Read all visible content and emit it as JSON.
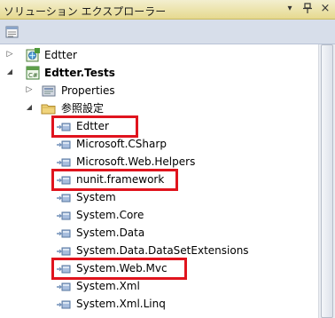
{
  "window": {
    "title": "ソリューション エクスプローラー",
    "dropdown_icon": "dropdown-arrow-icon",
    "pin_icon": "pin-icon",
    "close_icon": "close-icon",
    "pin_glyph": "ㅁ",
    "close_glyph": "×",
    "dropdown_glyph": "▾"
  },
  "toolbar": {
    "properties_icon": "properties-icon"
  },
  "tree": {
    "project_edtter": {
      "label": "Edtter",
      "expander": "▷"
    },
    "project_tests": {
      "label": "Edtter.Tests",
      "expander": "◢"
    },
    "properties": {
      "label": "Properties",
      "expander": "▷"
    },
    "references": {
      "label": "参照設定",
      "expander": "◢"
    },
    "refs": [
      "Edtter",
      "Microsoft.CSharp",
      "Microsoft.Web.Helpers",
      "nunit.framework",
      "System",
      "System.Core",
      "System.Data",
      "System.Data.DataSetExtensions",
      "System.Web.Mvc",
      "System.Xml",
      "System.Xml.Linq"
    ]
  },
  "colors": {
    "highlight": "#e0141e",
    "titlebar": "#e6d98f"
  }
}
